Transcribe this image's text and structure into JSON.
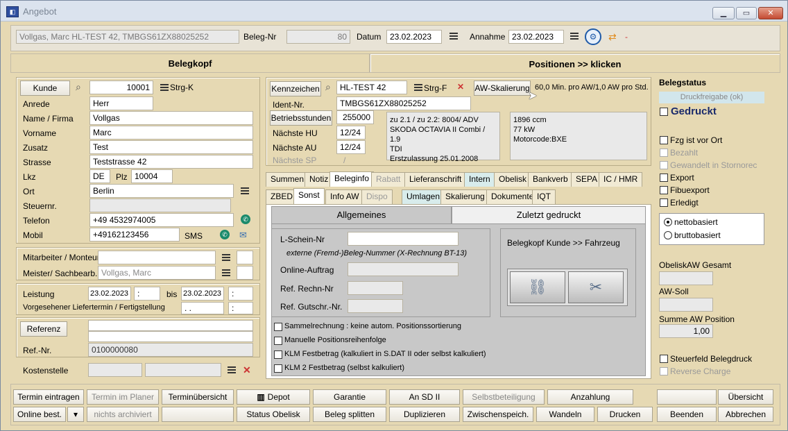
{
  "window": {
    "title": "Angebot"
  },
  "topbar": {
    "customer": "Vollgas, Marc HL-TEST 42, TMBGS61ZX88025252",
    "beleg_nr_label": "Beleg-Nr",
    "beleg_nr": "80",
    "datum_label": "Datum",
    "datum": "23.02.2023",
    "annahme_label": "Annahme",
    "annahme": "23.02.2023",
    "minus": "-"
  },
  "sections": {
    "belegkopf": "Belegkopf",
    "positionen": "Positionen >> klicken"
  },
  "kunde": {
    "kunde_btn": "Kunde",
    "kunde_nr": "10001",
    "strg_k": "Strg-K",
    "anrede_label": "Anrede",
    "anrede": "Herr",
    "name_label": "Name / Firma",
    "name": "Vollgas",
    "vorname_label": "Vorname",
    "vorname": "Marc",
    "zusatz_label": "Zusatz",
    "zusatz": "Test",
    "strasse_label": "Strasse",
    "strasse": "Teststrasse 42",
    "lkz_label": "Lkz",
    "lkz": "DE",
    "plz_label": "Plz",
    "plz": "10004",
    "ort_label": "Ort",
    "ort": "Berlin",
    "steuernr_label": "Steuernr.",
    "telefon_label": "Telefon",
    "telefon": "+49 4532974005",
    "mobil_label": "Mobil",
    "mobil": "+49162123456",
    "sms": "SMS"
  },
  "mitarbeiter": {
    "monteur_label": "Mitarbeiter / Monteur",
    "meister_label": "Meister/ Sachbearb.",
    "meister": "Vollgas, Marc"
  },
  "leistung": {
    "label": "Leistung",
    "von": "23.02.2023",
    "von_time": ":",
    "bis_label": "bis",
    "bis": "23.02.2023",
    "bis_time": ":",
    "liefer_label": "Vorgesehener Liefertermin / Fertigstellung",
    "liefer": ". .",
    "liefer_time": ":"
  },
  "referenz": {
    "btn": "Referenz",
    "refnr_label": "Ref.-Nr.",
    "refnr": "0100000080"
  },
  "kostenstelle": {
    "label": "Kostenstelle"
  },
  "fahrzeug": {
    "kennzeichen_btn": "Kennzeichen",
    "kennzeichen": "HL-TEST 42",
    "strg_f": "Strg-F",
    "aw_btn": "AW-Skalierung",
    "aw_text": "60,0 Min. pro AW/1,0 AW pro Std.",
    "ident_label": "Ident-Nr.",
    "ident": "TMBGS61ZX88025252",
    "betrieb_btn": "Betriebsstunden",
    "betrieb": "255000",
    "hu_label": "Nächste HU",
    "hu": "12/24",
    "au_label": "Nächste AU",
    "au": "12/24",
    "sp_label": "Nächste SP",
    "sp": "/",
    "info1": "zu 2.1 / zu 2.2: 8004/ ADV",
    "info2": "SKODA OCTAVIA II Combi / 1.9",
    "info3": "TDI",
    "info4": "Erstzulassung 25.01.2008",
    "tech1": "1896 ccm",
    "tech2": "77 kW",
    "tech3": "Motorcode:BXE"
  },
  "tabs_row1": [
    "Summen",
    "Notiz",
    "Beleginfo",
    "Rabatt",
    "Lieferanschrift",
    "Intern",
    "Obelisk",
    "Bankverb",
    "SEPA",
    "IC / HMR"
  ],
  "tabs_row2": [
    "ZBED",
    "Sonst",
    "Info AW",
    "Dispo",
    "Umlagen",
    "Skalierung",
    "Dokumente",
    "IQT"
  ],
  "subtabs": {
    "allgemeines": "Allgemeines",
    "zuletzt": "Zuletzt gedruckt"
  },
  "sonst": {
    "lschein_label": "L-Schein-Nr",
    "extern_note": "externe (Fremd-)Beleg-Nummer (X-Rechnung BT-13)",
    "online_label": "Online-Auftrag",
    "refrechn_label": "Ref. Rechn-Nr",
    "refgut_label": "Ref. Gutschr.-Nr.",
    "link_label": "Belegkopf  Kunde >> Fahrzeug",
    "cb1": "Sammelrechnung : keine autom. Positionssortierung",
    "cb2": "Manuelle Positionsreihenfolge",
    "cb3": "KLM Festbetrag (kalkuliert in S.DAT II oder selbst kalkuliert)",
    "cb4": "KLM 2 Festbetrag (selbst kalkuliert)"
  },
  "status": {
    "title": "Belegstatus",
    "druck": "Druckfreigabe (ok)",
    "gedruckt": "Gedruckt",
    "fzg": "Fzg ist vor Ort",
    "bezahlt": "Bezahlt",
    "gewandelt": "Gewandelt in Stornorec",
    "export": "Export",
    "fibu": "Fibuexport",
    "erledigt": "Erledigt",
    "netto": "nettobasiert",
    "brutto": "bruttobasiert",
    "obelisk_aw": "ObeliskAW Gesamt",
    "aw_soll": "AW-Soll",
    "summe_aw": "Summe AW Position",
    "summe_aw_val": "1,00",
    "steuerfeld": "Steuerfeld Belegdruck",
    "reverse": "Reverse Charge"
  },
  "bottom_row1": [
    "Termin eintragen",
    "Termin im Planer",
    "Terminübersicht",
    "Depot",
    "Garantie",
    "An SD II",
    "Selbstbeteiligung",
    "Anzahlung",
    "",
    "Übersicht"
  ],
  "bottom_row2": [
    "Online best.",
    "▾",
    "nichts archiviert",
    "",
    "Status Obelisk",
    "Beleg splitten",
    "Duplizieren",
    "Zwischenspeich.",
    "Wandeln",
    "Drucken",
    "Beenden",
    "Abbrechen"
  ]
}
